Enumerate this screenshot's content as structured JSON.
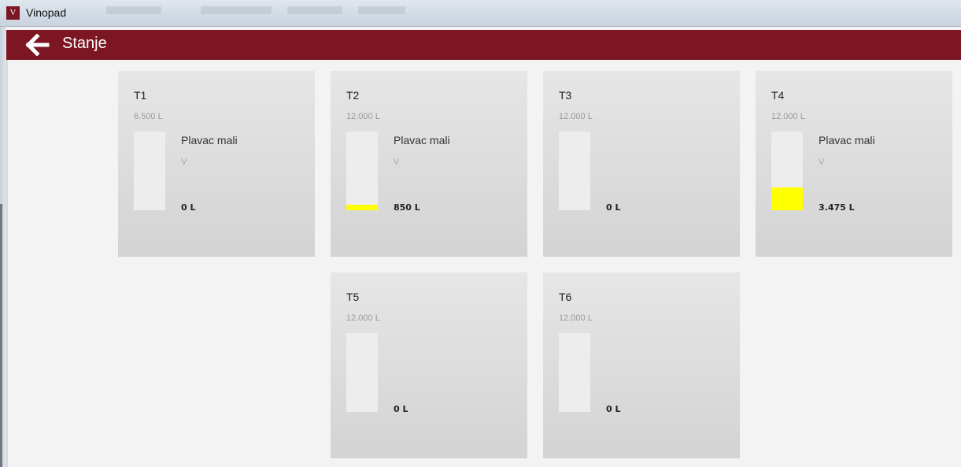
{
  "window": {
    "icon_letter": "V",
    "app_name": "Vinopad"
  },
  "header": {
    "title": "Stanje",
    "back_icon": "arrow-left-icon"
  },
  "colors": {
    "header": "#7b1622",
    "fill": "#ffff00",
    "card": "#dcdcdc"
  },
  "tanks": [
    {
      "name": "T1",
      "capacity": "6.500 L",
      "wine": "Plavac mali",
      "type": "V",
      "amount": "0 L",
      "fill_fraction": 0
    },
    {
      "name": "T2",
      "capacity": "12.000 L",
      "wine": "Plavac mali",
      "type": "V",
      "amount": "850 L",
      "fill_fraction": 0.0708
    },
    {
      "name": "T3",
      "capacity": "12.000 L",
      "wine": "",
      "type": "",
      "amount": "0 L",
      "fill_fraction": 0
    },
    {
      "name": "T4",
      "capacity": "12.000 L",
      "wine": "Plavac mali",
      "type": "V",
      "amount": "3.475 L",
      "fill_fraction": 0.2896
    },
    {
      "name": "T5",
      "capacity": "12.000 L",
      "wine": "",
      "type": "",
      "amount": "0 L",
      "fill_fraction": 0
    },
    {
      "name": "T6",
      "capacity": "12.000 L",
      "wine": "",
      "type": "",
      "amount": "0 L",
      "fill_fraction": 0
    }
  ]
}
